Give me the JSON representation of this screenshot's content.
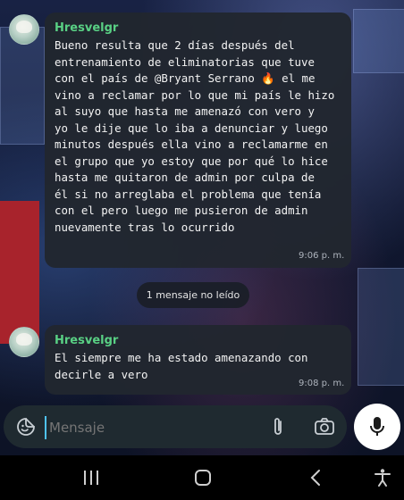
{
  "messages": [
    {
      "sender": "Hresvelgr",
      "text": "Bueno resulta que 2 días después del\nentrenamiento de eliminatorias que tuve\ncon el país de @Bryant Serrano 🔥 el me\nvino a reclamar por lo que mi país le hizo\nal suyo que hasta me amenazó con vero y\nyo le dije que lo iba a denunciar y luego\nminutos después ella vino a reclamarme en\nel grupo que yo estoy que por qué lo hice\nhasta me quitaron de admin por culpa de\nél si no arreglaba el problema que tenía\ncon el pero luego me pusieron de admin\nnuevamente tras lo ocurrido",
      "time": "9:06 p. m."
    },
    {
      "sender": "Hresvelgr",
      "text": "El siempre me ha estado amenazando con\ndecirle a vero",
      "time": "9:08 p. m."
    }
  ],
  "unread_label": "1 mensaje no leído",
  "composer": {
    "placeholder": "Mensaje",
    "icons": {
      "emoji": "sticker-icon",
      "attach": "paperclip-icon",
      "camera": "camera-icon",
      "mic": "microphone-icon"
    }
  },
  "navigation": {
    "icons": [
      "recents-icon",
      "home-icon",
      "back-icon",
      "accessibility-icon"
    ]
  },
  "colors": {
    "sender": "#59d084",
    "bubble": "#21262f",
    "input": "#1f2a30"
  }
}
